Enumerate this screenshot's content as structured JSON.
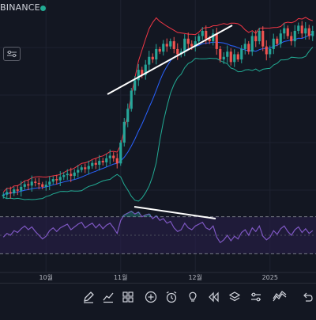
{
  "header": {
    "exchange": "BINANCE"
  },
  "colors": {
    "background": "#131722",
    "grid": "#1e2230",
    "up": "#26a69a",
    "down": "#ef5350",
    "bb_upper": "#f23645",
    "bb_lower": "#22ab94",
    "bb_basis": "#2962ff",
    "rsi": "#7e57c2",
    "rsi_band": "#2a1f4d",
    "trendline": "#ffffff"
  },
  "chart_data": {
    "type": "candlestick",
    "indicators": [
      "Bollinger Bands",
      "RSI"
    ],
    "x_ticks": [
      {
        "label": "10월",
        "index": 12
      },
      {
        "label": "11월",
        "index": 33
      },
      {
        "label": "12월",
        "index": 54
      },
      {
        "label": "2025",
        "index": 75
      }
    ],
    "closes": [
      40,
      41,
      40.5,
      42,
      41.5,
      43,
      44,
      43.5,
      45,
      44.5,
      44,
      43,
      43.8,
      45,
      46,
      45.5,
      46.8,
      47.5,
      48,
      47.2,
      48.5,
      49.5,
      50.5,
      49.8,
      51,
      52.2,
      51.5,
      53,
      52.4,
      54,
      55,
      54,
      52,
      60,
      68,
      73,
      80,
      84,
      88,
      86,
      90,
      93,
      92,
      96,
      95,
      98,
      97,
      99,
      96,
      94,
      95,
      100,
      98,
      97,
      99,
      101,
      103,
      100,
      99,
      102,
      96,
      92,
      93,
      95,
      91,
      94,
      92,
      96,
      98,
      95,
      101,
      99,
      103,
      97,
      94,
      96,
      100,
      98,
      102,
      104,
      101,
      99,
      103,
      105,
      102,
      104,
      101,
      103
    ],
    "rsi": [
      48,
      52,
      50,
      55,
      53,
      57,
      60,
      56,
      59,
      54,
      50,
      46,
      49,
      55,
      58,
      54,
      58,
      60,
      62,
      56,
      59,
      62,
      64,
      58,
      61,
      63,
      58,
      62,
      57,
      61,
      63,
      58,
      52,
      66,
      72,
      74,
      76,
      73,
      75,
      70,
      72,
      73,
      68,
      71,
      66,
      68,
      63,
      65,
      58,
      54,
      56,
      63,
      58,
      56,
      60,
      62,
      64,
      58,
      56,
      60,
      48,
      42,
      45,
      50,
      44,
      49,
      46,
      53,
      56,
      50,
      58,
      54,
      60,
      49,
      45,
      48,
      55,
      51,
      57,
      60,
      54,
      50,
      56,
      59,
      53,
      57,
      52,
      55
    ],
    "rsi_band": [
      30,
      70
    ]
  },
  "toolbar": {
    "tools": [
      "pen-icon",
      "chart-add-icon",
      "grid-icon",
      "plus-circle-icon",
      "alarm-icon",
      "bulb-icon",
      "rewind-icon",
      "layers-icon",
      "sliders-icon",
      "wave-icon",
      "undo-icon"
    ]
  }
}
